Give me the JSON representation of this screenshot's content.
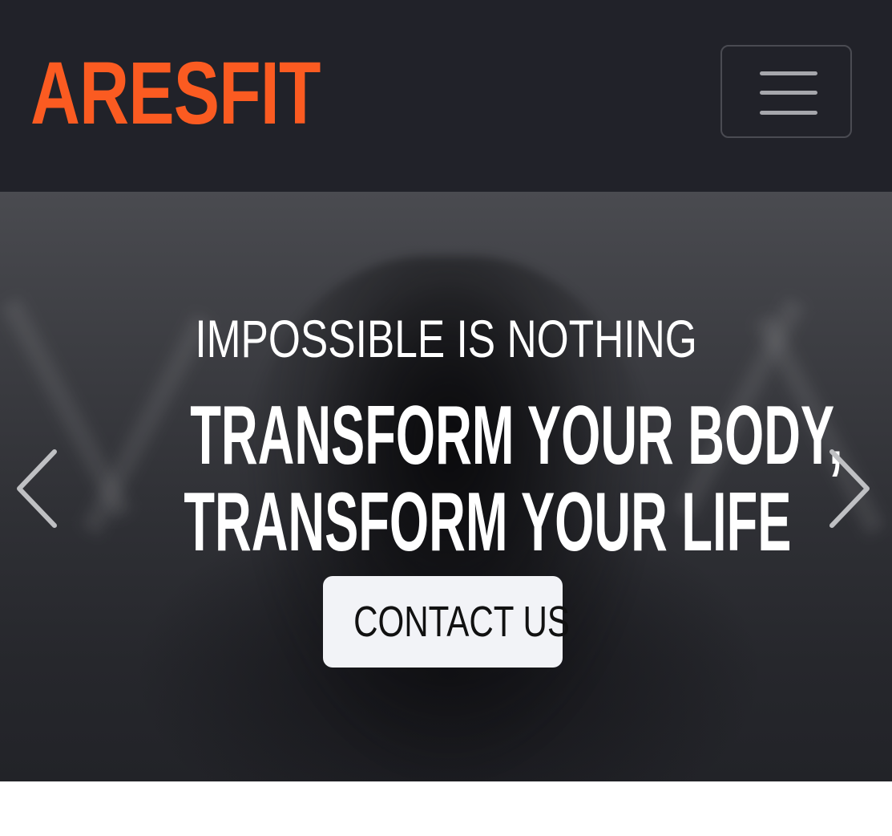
{
  "navbar": {
    "brand": "ARESFIT",
    "toggle_icon": "hamburger-menu-icon"
  },
  "hero": {
    "subtitle": "IMPOSSIBLE IS NOTHING",
    "title_line1": "TRANSFORM YOUR BODY,",
    "title_line2": "TRANSFORM YOUR LIFE",
    "cta_label": "CONTACT US",
    "prev_icon": "chevron-left-icon",
    "next_icon": "chevron-right-icon"
  },
  "colors": {
    "navbar_bg": "#212229",
    "brand": "#fb5b21",
    "button_bg": "#f2f3f7"
  }
}
